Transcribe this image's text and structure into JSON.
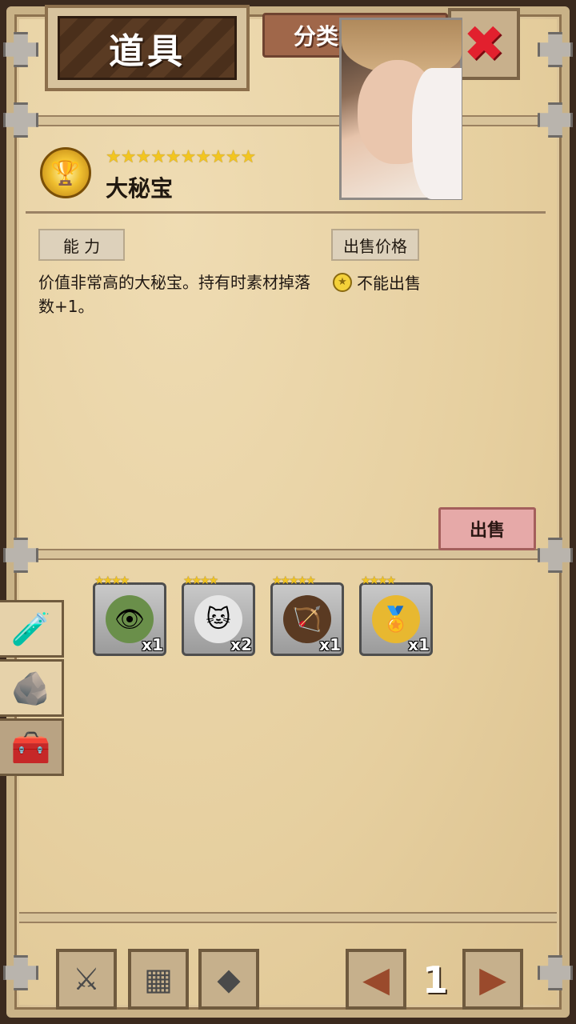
{
  "header": {
    "title": "道具",
    "category_label": "分类",
    "close_symbol": "✖"
  },
  "item": {
    "stars": "★★★★★★★★★★",
    "name": "大秘宝",
    "icon": "trophy-medal-icon",
    "icon_glyph": "🏆"
  },
  "ability": {
    "label": "能 力",
    "description": "价值非常高的大秘宝。持有时素材掉落数+1。"
  },
  "price": {
    "label": "出售价格",
    "coin_glyph": "★",
    "value": "不能出售"
  },
  "sell_button": {
    "label": "出售"
  },
  "inventory": [
    {
      "name": "eye-orb-item",
      "stars": "★★★★",
      "count": "x1",
      "glyph": "👁",
      "color": "#6a8f4a"
    },
    {
      "name": "lucky-cat-item",
      "stars": "★★★★",
      "count": "x2",
      "glyph": "🐱",
      "color": "#e6e6e6"
    },
    {
      "name": "bow-relic-item",
      "stars": "★★★★★",
      "count": "x1",
      "glyph": "🏹",
      "color": "#5a3a22"
    },
    {
      "name": "gold-medal-item",
      "stars": "★★★★",
      "count": "x1",
      "glyph": "🏅",
      "color": "#e8b830"
    }
  ],
  "side_tabs": [
    {
      "name": "potion-tab",
      "glyph": "🧪",
      "icon": "potion-icon"
    },
    {
      "name": "ore-tab",
      "glyph": "🪨",
      "icon": "ore-icon"
    },
    {
      "name": "treasure-tab",
      "glyph": "🧰",
      "icon": "chest-icon",
      "active": true
    }
  ],
  "bottom_bar": {
    "weapon_glyph": "⚔",
    "armor_glyph": "▦",
    "gem_glyph": "◆",
    "prev_glyph": "◀",
    "next_glyph": "▶",
    "page": "1"
  },
  "colors": {
    "accent_red": "#e2202e",
    "star_gold": "#f2c521",
    "parchment": "#e8d3a8"
  }
}
